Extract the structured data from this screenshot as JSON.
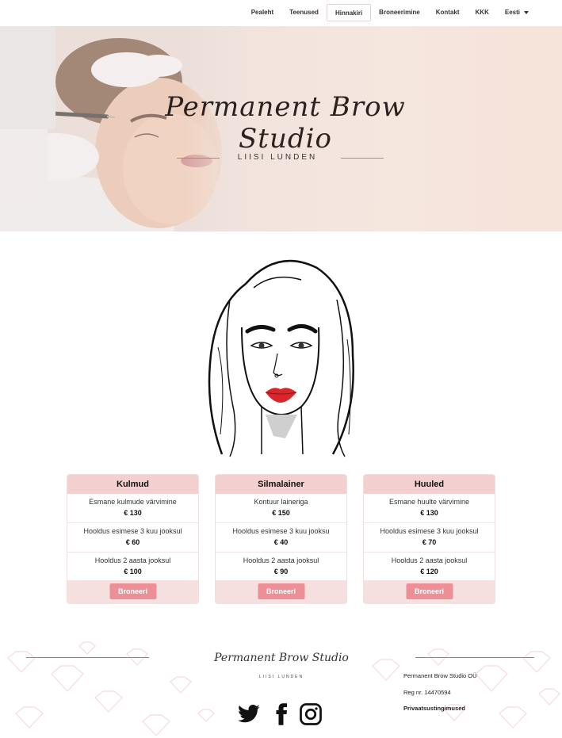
{
  "nav": {
    "items": [
      {
        "label": "Pealeht"
      },
      {
        "label": "Teenused"
      },
      {
        "label": "Hinnakiri",
        "active": true
      },
      {
        "label": "Broneerimine"
      },
      {
        "label": "Kontakt"
      },
      {
        "label": "KKK"
      },
      {
        "label": "Eesti",
        "has_dropdown": true
      }
    ]
  },
  "hero": {
    "title": "Permanent Brow Studio",
    "subtitle": "LIISI LUNDEN"
  },
  "price_cards": [
    {
      "title": "Kulmud",
      "rows": [
        {
          "name": "Esmane kulmude värvimine",
          "price": "€ 130"
        },
        {
          "name": "Hooldus esimese 3 kuu jooksul",
          "price": "€ 60"
        },
        {
          "name": "Hooldus 2 aasta jooksul",
          "price": "€ 100"
        }
      ],
      "button": "Broneeri"
    },
    {
      "title": "Silmalainer",
      "rows": [
        {
          "name": "Kontuur laineriga",
          "price": "€ 150"
        },
        {
          "name": "Hooldus esimese 3 kuu jooksu",
          "price": "€ 40"
        },
        {
          "name": "Hooldus 2 aasta jooksul",
          "price": "€ 90"
        }
      ],
      "button": "Broneeri"
    },
    {
      "title": "Huuled",
      "rows": [
        {
          "name": "Esmane huulte värvimine",
          "price": "€ 130"
        },
        {
          "name": "Hooldus esimese 3 kuu jooksul",
          "price": "€ 70"
        },
        {
          "name": "Hooldus 2 aasta jooksul",
          "price": "€ 120"
        }
      ],
      "button": "Broneeri"
    }
  ],
  "footer": {
    "logo_title": "Permanent Brow Studio",
    "logo_subtitle": "LIISI LUNDEN",
    "company": "Permanent Brow Studio OÜ",
    "reg": "Reg nr. 14470594",
    "privacy_link": "Privaatsustingimused",
    "social_icons": [
      "twitter-icon",
      "facebook-icon",
      "instagram-icon"
    ]
  },
  "colors": {
    "card_header": "#f3cfcf",
    "button": "#ec8f96",
    "lips": "#d9262a"
  }
}
